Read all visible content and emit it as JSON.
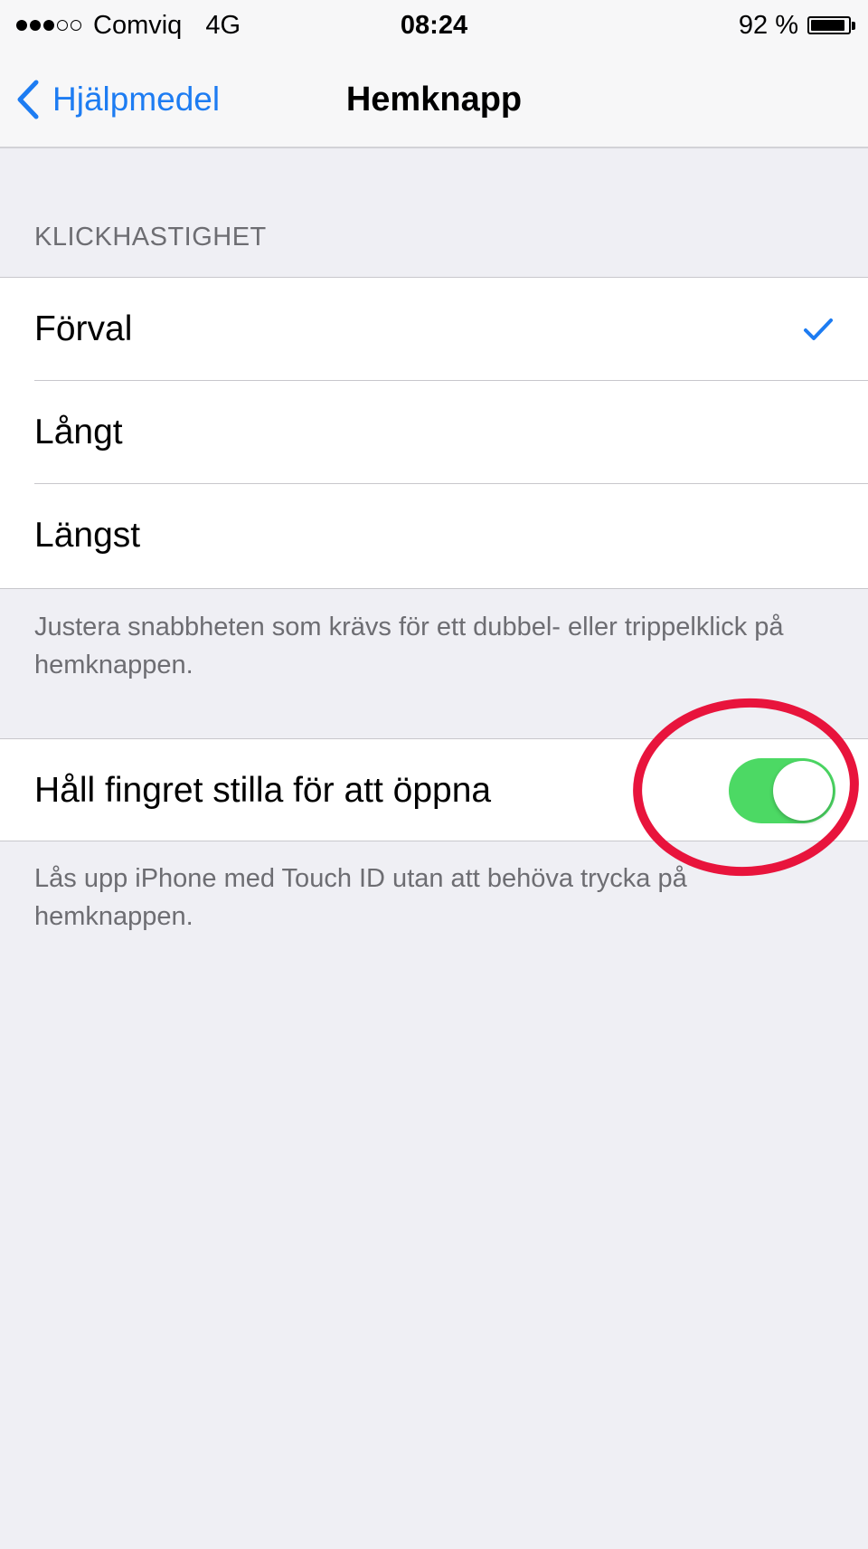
{
  "status_bar": {
    "signal_bars_filled": 3,
    "signal_bars_total": 5,
    "carrier": "Comviq",
    "network": "4G",
    "time": "08:24",
    "battery_percent_text": "92 %",
    "battery_level": 0.92
  },
  "nav": {
    "back_label": "Hjälpmedel",
    "back_icon": "chevron-left-icon",
    "title": "Hemknapp"
  },
  "click_speed": {
    "header": "KLICKHASTIGHET",
    "options": [
      {
        "label": "Förval",
        "selected": true
      },
      {
        "label": "Långt",
        "selected": false
      },
      {
        "label": "Längst",
        "selected": false
      }
    ],
    "note": "Justera snabbheten som krävs för ett dubbel- eller trippelklick på hemknappen."
  },
  "rest_finger": {
    "label": "Håll fingret stilla för att öppna",
    "enabled": true,
    "note": "Lås upp iPhone med Touch ID utan att behöva trycka på hemknappen."
  },
  "colors": {
    "accent": "#1d7cf2",
    "toggle_on": "#4cd964",
    "annotation": "#e8143c",
    "background": "#efeff4"
  }
}
